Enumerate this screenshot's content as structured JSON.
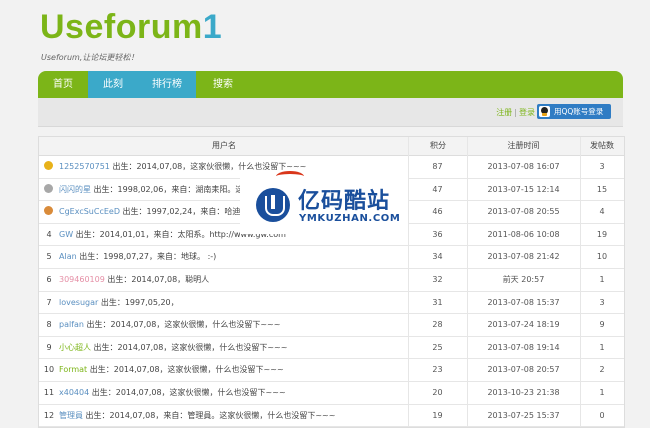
{
  "header": {
    "logo_main": "Useforum",
    "logo_num": "1",
    "slogan": "Useforum,让论坛更轻松！"
  },
  "nav": {
    "items": [
      "首页",
      "此刻",
      "排行榜",
      "搜索"
    ]
  },
  "userbar": {
    "register": "注册",
    "separator": "|",
    "login": "登录",
    "qq_login": "用QQ账号登录"
  },
  "table": {
    "headers": [
      "用户名",
      "积分",
      "注册时间",
      "发帖数"
    ],
    "rows": [
      {
        "rank": "1",
        "medal": "#e8b21a",
        "name": "1252570751",
        "bio": "出生：2014,07,08，这家伙很懒，什么也没留下~~~",
        "points": "87",
        "date": "2013-07-08 16:07",
        "posts": "3"
      },
      {
        "rank": "2",
        "medal": "#a8a8a8",
        "name": "闪闪的星",
        "bio": "出生：1998,02,06，来自：湖南耒阳。这家伙",
        "points": "47",
        "date": "2013-07-15 12:14",
        "posts": "15"
      },
      {
        "rank": "3",
        "medal": "#d98b3a",
        "name": "CgExcSuCcEeD",
        "bio": "出生：1997,02,24，来自：哈迪斯星。",
        "points": "46",
        "date": "2013-07-08 20:55",
        "posts": "4"
      },
      {
        "rank": "4",
        "medal": "",
        "name": "GW",
        "bio": "出生：2014,01,01，来自：太阳系。http://www.gw.com",
        "points": "36",
        "date": "2011-08-06 10:08",
        "posts": "19"
      },
      {
        "rank": "5",
        "medal": "",
        "name": "Alan",
        "bio": "出生：1998,07,27，来自：地球。 :-)",
        "points": "34",
        "date": "2013-07-08 21:42",
        "posts": "10"
      },
      {
        "rank": "6",
        "medal": "",
        "name": "309460109",
        "bio": "出生：2014,07,08，聪明人",
        "points": "32",
        "date": "前天 20:57",
        "posts": "1",
        "name_color": "#e58fa6"
      },
      {
        "rank": "7",
        "medal": "",
        "name": "lovesugar",
        "bio": "出生：1997,05,20，",
        "points": "31",
        "date": "2013-07-08 15:37",
        "posts": "3"
      },
      {
        "rank": "8",
        "medal": "",
        "name": "palfan",
        "bio": "出生：2014,07,08，这家伙很懒，什么也没留下~~~",
        "points": "28",
        "date": "2013-07-24 18:19",
        "posts": "9"
      },
      {
        "rank": "9",
        "medal": "",
        "name": "小心超人",
        "bio": "出生：2014,07,08，这家伙很懒，什么也没留下~~~",
        "points": "25",
        "date": "2013-07-08 19:14",
        "posts": "1",
        "name_color": "#7cb518"
      },
      {
        "rank": "10",
        "medal": "",
        "name": "Format",
        "bio": "出生：2014,07,08，这家伙很懒，什么也没留下~~~",
        "points": "23",
        "date": "2013-07-08 20:57",
        "posts": "2",
        "name_color": "#7cb518"
      },
      {
        "rank": "11",
        "medal": "",
        "name": "x40404",
        "bio": "出生：2014,07,08，这家伙很懒，什么也没留下~~~",
        "points": "20",
        "date": "2013-10-23 21:38",
        "posts": "1"
      },
      {
        "rank": "12",
        "medal": "",
        "name": "管理員",
        "bio": "出生：2014,07,08，来自：管理員。这家伙很懒，什么也没留下~~~",
        "points": "19",
        "date": "2013-07-25 15:37",
        "posts": "0"
      }
    ]
  },
  "watermark": {
    "brand": "亿码酷站",
    "domain": "YMKUZHAN.COM"
  }
}
